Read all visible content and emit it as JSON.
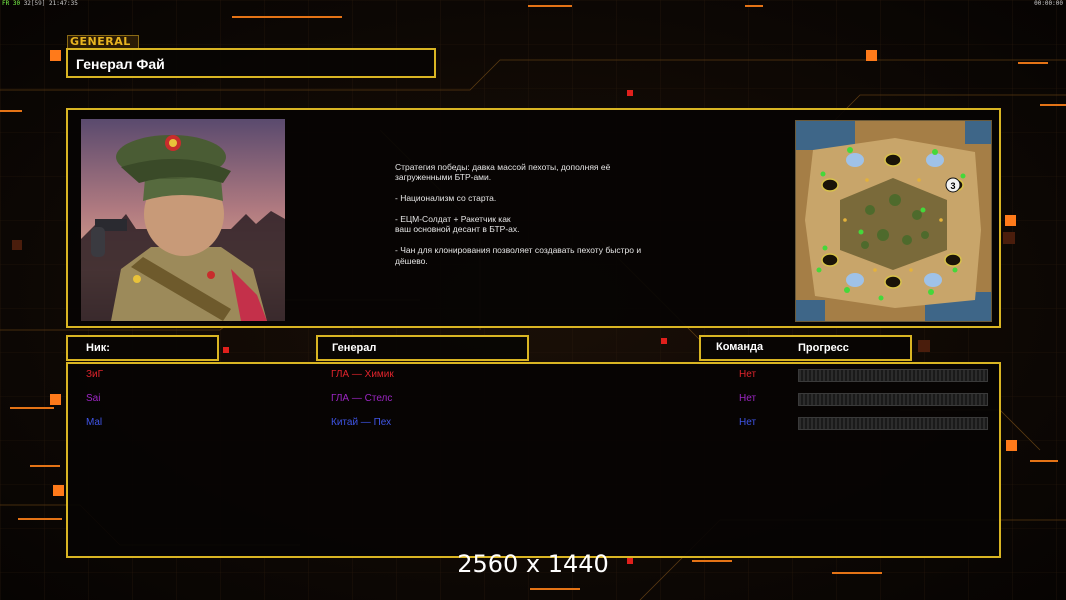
{
  "hud": {
    "fps_label": "FR 30",
    "fps_value": "32",
    "sub_value": "[59]",
    "clock": "21:47:35",
    "right_clock": "00:00:00"
  },
  "general_tag": "GENERAL",
  "title": "Генерал Фай",
  "description": {
    "strategy_lines": [
      "Стратегия победы: давка массой пехоты, дополняя её",
      " загруженными БТР-ами."
    ],
    "point1": "- Национализм со старта.",
    "point2_lines": [
      "- ЕЦМ-Солдат + Ракетчик как",
      "ваш основной десант в БТР-ах."
    ],
    "point3_lines": [
      "- Чан для клонирования позволяет создавать пехоту быстро и",
      " дёшево."
    ]
  },
  "minimap": {
    "start_marker": "3"
  },
  "headers": {
    "nick": "Ник:",
    "general": "Генерал",
    "team": "Команда",
    "progress": "Прогресс"
  },
  "players": [
    {
      "nick": "ЗиГ",
      "general": "ГЛА — Химик",
      "team": "Нет",
      "color": "#e0242c",
      "progress": 0
    },
    {
      "nick": "Sai",
      "general": "ГЛА — Стелс",
      "team": "Нет",
      "color": "#9b26c2",
      "progress": 0
    },
    {
      "nick": "Mal",
      "general": "Китай — Пех",
      "team": "Нет",
      "color": "#3f55e6",
      "progress": 0
    }
  ],
  "accent_color": "#d9b523",
  "watermark": "2560 x 1440"
}
